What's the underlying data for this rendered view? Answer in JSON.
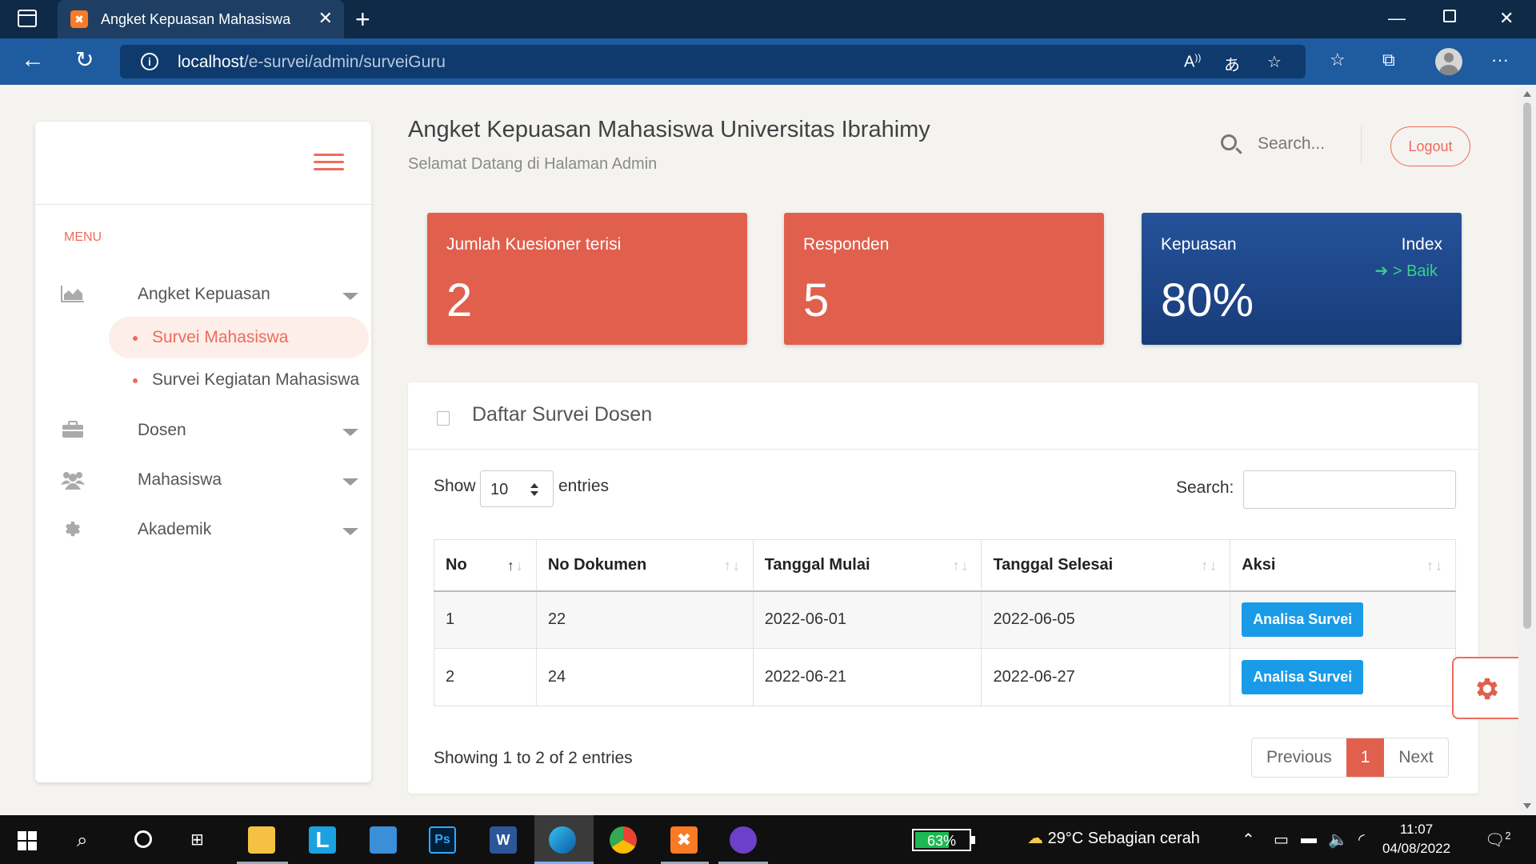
{
  "browser": {
    "tab_title": "Angket Kepuasan Mahasiswa",
    "tab_favicon_letter": "✖",
    "url_host": "localhost",
    "url_path": "/e-survei/admin/surveiGuru"
  },
  "sidebar": {
    "menu_label": "MENU",
    "items": [
      {
        "label": "Angket Kepuasan",
        "icon": "area-chart-icon"
      },
      {
        "label": "Dosen",
        "icon": "briefcase-icon"
      },
      {
        "label": "Mahasiswa",
        "icon": "users-icon"
      },
      {
        "label": "Akademik",
        "icon": "gear-icon"
      }
    ],
    "subitems": [
      {
        "label": "Survei Mahasiswa",
        "active": true
      },
      {
        "label": "Survei Kegiatan Mahasiswa",
        "active": false
      }
    ]
  },
  "header": {
    "title": "Angket Kepuasan Mahasiswa Universitas Ibrahimy",
    "subtitle": "Selamat Datang di Halaman Admin",
    "search_placeholder": "Search...",
    "logout_label": "Logout"
  },
  "stats": [
    {
      "label": "Jumlah Kuesioner terisi",
      "value": "2",
      "color": "#e0604d"
    },
    {
      "label": "Responden",
      "value": "5",
      "color": "#e0604d"
    },
    {
      "label": "Kepuasan",
      "value": "80%",
      "right_label": "Index",
      "trend": "> Baik",
      "color": "#1f4e8f"
    }
  ],
  "survey_card": {
    "title": "Daftar Survei Dosen",
    "show_label": "Show",
    "entries_value": "10",
    "entries_label": "entries",
    "search_label": "Search:",
    "columns": [
      "No",
      "No Dokumen",
      "Tanggal Mulai",
      "Tanggal Selesai",
      "Aksi"
    ],
    "rows": [
      {
        "no": "1",
        "dokumen": "22",
        "mulai": "2022-06-01",
        "selesai": "2022-06-05",
        "aksi": "Analisa Survei"
      },
      {
        "no": "2",
        "dokumen": "24",
        "mulai": "2022-06-21",
        "selesai": "2022-06-27",
        "aksi": "Analisa Survei"
      }
    ],
    "info": "Showing 1 to 2 of 2 entries",
    "pagination": {
      "previous": "Previous",
      "current": "1",
      "next": "Next"
    }
  },
  "taskbar": {
    "battery": "63%",
    "battery_level": 0.63,
    "weather": "29°C  Sebagian cerah",
    "time": "11:07",
    "date": "04/08/2022",
    "notification_count": "2"
  },
  "colors": {
    "accent": "#ef6b5b",
    "stat_red": "#e0604d",
    "stat_blue": "#1f4e8f",
    "button_blue": "#1a9be8",
    "browser_dark": "#0e2a47",
    "browser_bar": "#1e5b9f"
  }
}
